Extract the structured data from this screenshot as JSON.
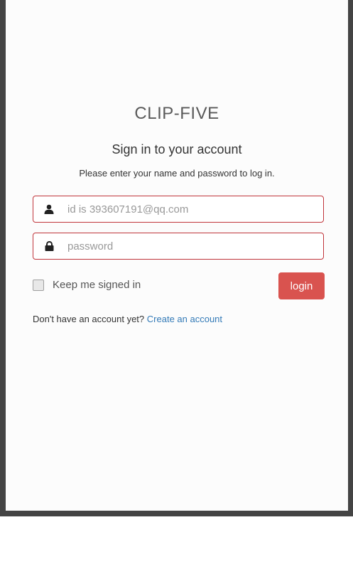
{
  "brand": "CLIP-FIVE",
  "heading": "Sign in to your account",
  "subtitle": "Please enter your name and password to log in.",
  "username": {
    "placeholder": "id is 393607191@qq.com",
    "icon": "user-icon"
  },
  "password": {
    "placeholder": "password",
    "icon": "lock-icon"
  },
  "remember": {
    "label": "Keep me signed in",
    "checked": false
  },
  "login_label": "login",
  "signup": {
    "prompt": "Don't have an account yet?",
    "link_label": "Create an account"
  },
  "colors": {
    "frame": "#444444",
    "accent": "#d9534f",
    "field_border": "#c0343a",
    "link": "#337ab7"
  }
}
